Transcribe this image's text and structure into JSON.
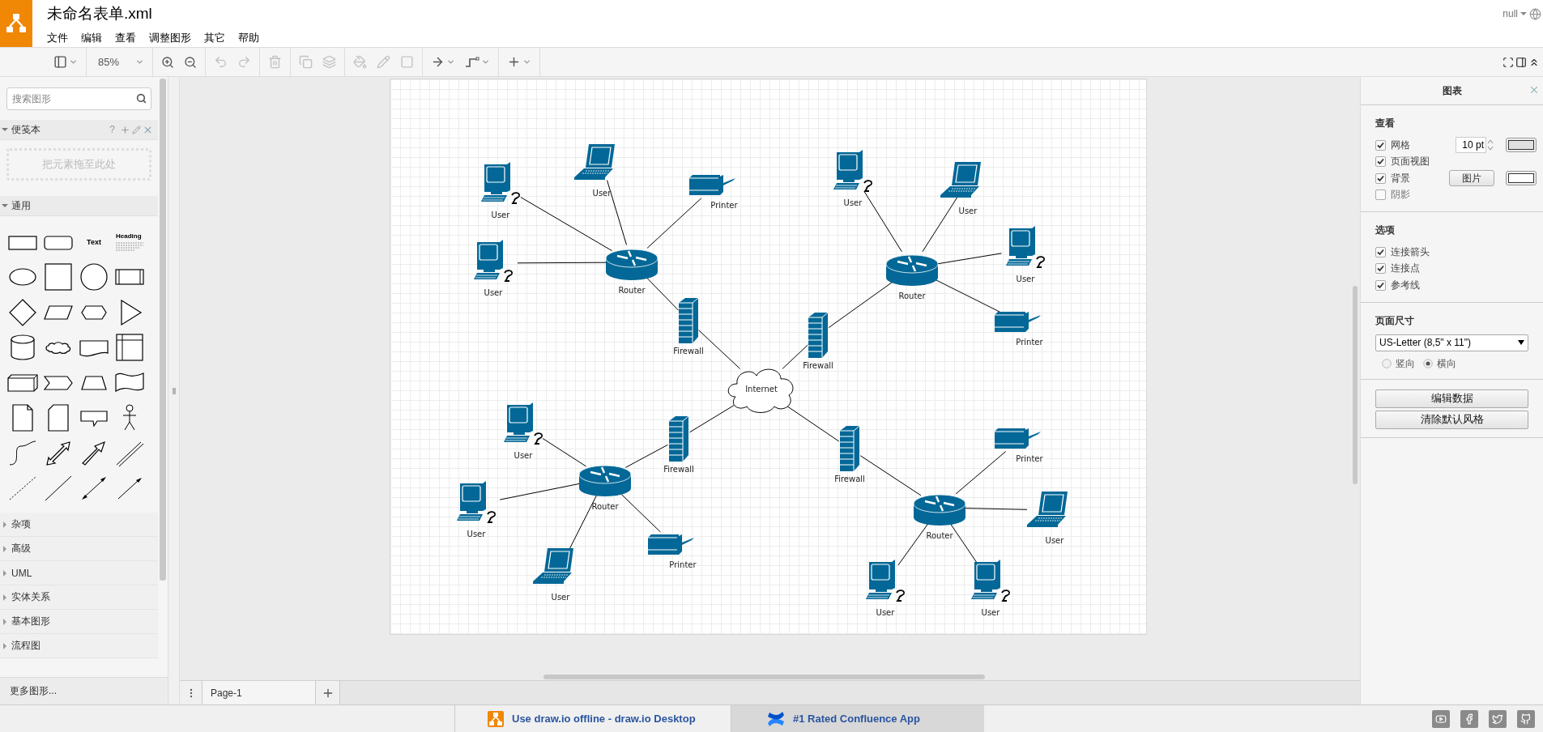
{
  "app": {
    "file_title": "未命名表单.xml",
    "menu": [
      "文件",
      "编辑",
      "查看",
      "调整图形",
      "其它",
      "帮助"
    ],
    "user": "null"
  },
  "toolbar": {
    "groups": [
      [
        {
          "kind": "layout",
          "disabled": false
        }
      ],
      [
        {
          "kind": "zoom",
          "label": "85%",
          "disabled": false
        }
      ],
      [
        {
          "kind": "zoom-in",
          "disabled": false
        },
        {
          "kind": "zoom-out",
          "disabled": false
        }
      ],
      [
        {
          "kind": "undo",
          "disabled": true
        },
        {
          "kind": "redo",
          "disabled": true
        }
      ],
      [
        {
          "kind": "delete",
          "disabled": true
        }
      ],
      [
        {
          "kind": "to-front",
          "disabled": true
        },
        {
          "kind": "to-back",
          "disabled": true
        }
      ],
      [
        {
          "kind": "fill",
          "disabled": true
        },
        {
          "kind": "line-color",
          "disabled": true
        },
        {
          "kind": "shadow",
          "disabled": true
        }
      ],
      [
        {
          "kind": "connection",
          "disabled": false
        },
        {
          "kind": "waypoints",
          "disabled": false
        }
      ],
      [
        {
          "kind": "insert",
          "disabled": false
        }
      ]
    ],
    "right": [
      {
        "kind": "fullscreen"
      },
      {
        "kind": "format-panel"
      },
      {
        "kind": "collapse"
      }
    ]
  },
  "sidebar": {
    "search_placeholder": "搜索图形",
    "scratchpad": {
      "title": "便笺本",
      "expanded": true,
      "help": "?",
      "drop_hint": "把元素拖至此处"
    },
    "general": {
      "title": "通用",
      "expanded": true,
      "shapes": [
        {
          "kind": "rect"
        },
        {
          "kind": "rounded"
        },
        {
          "kind": "text",
          "label": "Text"
        },
        {
          "kind": "heading",
          "label": "Heading"
        },
        {
          "kind": "ellipse"
        },
        {
          "kind": "square"
        },
        {
          "kind": "circle"
        },
        {
          "kind": "process"
        },
        {
          "kind": "diamond"
        },
        {
          "kind": "parallelogram"
        },
        {
          "kind": "hexagon"
        },
        {
          "kind": "triangle"
        },
        {
          "kind": "cylinder"
        },
        {
          "kind": "cloud"
        },
        {
          "kind": "document"
        },
        {
          "kind": "internal-storage"
        },
        {
          "kind": "cube"
        },
        {
          "kind": "step"
        },
        {
          "kind": "trapezoid"
        },
        {
          "kind": "tape"
        },
        {
          "kind": "note"
        },
        {
          "kind": "card"
        },
        {
          "kind": "callout"
        },
        {
          "kind": "actor"
        },
        {
          "kind": "curve"
        },
        {
          "kind": "double-arrow"
        },
        {
          "kind": "arrow"
        },
        {
          "kind": "link"
        },
        {
          "kind": "dashed-line"
        },
        {
          "kind": "line"
        },
        {
          "kind": "double-connector"
        },
        {
          "kind": "connector"
        }
      ]
    },
    "libraries": [
      {
        "title": "杂项",
        "expanded": false
      },
      {
        "title": "高级",
        "expanded": false
      },
      {
        "title": "UML",
        "expanded": false
      },
      {
        "title": "实体关系",
        "expanded": false
      },
      {
        "title": "基本图形",
        "expanded": false
      },
      {
        "title": "流程图",
        "expanded": false
      }
    ],
    "more_shapes": "更多图形..."
  },
  "diagram": {
    "nodes": [
      {
        "kind": "desktop",
        "label": "User"
      },
      {
        "kind": "laptop",
        "label": "User"
      },
      {
        "kind": "printer",
        "label": "Printer"
      },
      {
        "kind": "desktop",
        "label": "User"
      },
      {
        "kind": "router",
        "label": "Router"
      },
      {
        "kind": "firewall",
        "label": "Firewall"
      },
      {
        "kind": "desktop",
        "label": "User"
      },
      {
        "kind": "laptop",
        "label": "User"
      },
      {
        "kind": "desktop",
        "label": "User"
      },
      {
        "kind": "printer",
        "label": "Printer"
      },
      {
        "kind": "router",
        "label": "Router"
      },
      {
        "kind": "firewall",
        "label": "Firewall"
      },
      {
        "kind": "cloud",
        "label": "Internet"
      },
      {
        "kind": "desktop",
        "label": "User"
      },
      {
        "kind": "firewall",
        "label": "Firewall"
      },
      {
        "kind": "router",
        "label": "Router"
      },
      {
        "kind": "desktop",
        "label": "User"
      },
      {
        "kind": "printer",
        "label": "Printer"
      },
      {
        "kind": "laptop",
        "label": "User"
      },
      {
        "kind": "printer",
        "label": "Printer"
      },
      {
        "kind": "firewall",
        "label": "Firewall"
      },
      {
        "kind": "router",
        "label": "Router"
      },
      {
        "kind": "laptop",
        "label": "User"
      },
      {
        "kind": "desktop",
        "label": "User"
      },
      {
        "kind": "desktop",
        "label": "User"
      }
    ]
  },
  "pages": [
    {
      "label": "Page-1",
      "selected": true
    }
  ],
  "format_panel": {
    "title": "图表",
    "view": {
      "heading": "查看",
      "options": [
        {
          "kind": "grid",
          "label": "网格",
          "checked": true,
          "value": "10 pt"
        },
        {
          "kind": "plain",
          "label": "页面视图",
          "checked": true
        },
        {
          "kind": "background",
          "label": "背景",
          "checked": true,
          "button": "图片"
        },
        {
          "kind": "plain",
          "label": "阴影",
          "checked": false
        }
      ]
    },
    "options": {
      "heading": "选项",
      "options": [
        {
          "label": "连接箭头",
          "checked": true
        },
        {
          "label": "连接点",
          "checked": true
        },
        {
          "label": "参考线",
          "checked": true
        }
      ]
    },
    "page_size": {
      "heading": "页面尺寸",
      "value": "US-Letter (8,5\" x 11\")",
      "orientation": [
        {
          "label": "竖向",
          "selected": false
        },
        {
          "label": "横向",
          "selected": true
        }
      ]
    },
    "buttons": [
      "编辑数据",
      "清除默认风格"
    ]
  },
  "footer": {
    "links": [
      {
        "kind": "drawio",
        "label": "Use draw.io offline - draw.io Desktop",
        "selected": false
      },
      {
        "kind": "confluence",
        "label": "#1 Rated Confluence App",
        "selected": true
      }
    ],
    "social": [
      {
        "kind": "youtube"
      },
      {
        "kind": "facebook"
      },
      {
        "kind": "twitter"
      },
      {
        "kind": "github"
      }
    ]
  }
}
